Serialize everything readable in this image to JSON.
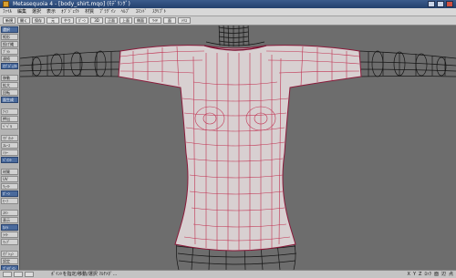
{
  "window": {
    "title": "Metasequoia 4 - [body_shirt.mqo] (ﾓﾃﾞﾘﾝｸﾞ)"
  },
  "menu": [
    "ﾌｧｲﾙ",
    "編集",
    "選択",
    "表示",
    "ｵﾌﾞｼﾞｪｸﾄ",
    "材質",
    "ﾌﾟﾗｸﾞｲﾝ",
    "ﾍﾙﾌﾟ",
    "ｺﾏﾝﾄﾞ",
    "ｽｸﾘﾌﾟﾄ"
  ],
  "toolbar": [
    "新規",
    "開く",
    "保存",
    "元",
    "やり",
    "ﾎﾞｰﾝ",
    "3D",
    "正面",
    "上面",
    "側面",
    "ﾜｲﾔ",
    "面",
    "ﾃｸｽ"
  ],
  "sidebar": {
    "items": [
      {
        "label": "選択",
        "kind": "hdr"
      },
      {
        "label": "矩形",
        "kind": ""
      },
      {
        "label": "投げ縄",
        "kind": ""
      },
      {
        "label": "ﾌﾞﾗｼ",
        "kind": ""
      },
      {
        "label": "連続",
        "kind": ""
      },
      {
        "label": "ｵﾌﾞｼﾞｪｸﾄ",
        "kind": "hdr"
      },
      {
        "label": "移動",
        "kind": "gap"
      },
      {
        "label": "拡大",
        "kind": ""
      },
      {
        "label": "回転",
        "kind": ""
      },
      {
        "label": "面生成",
        "kind": "hdr"
      },
      {
        "label": "ﾅｲﾌ",
        "kind": "gap"
      },
      {
        "label": "押出",
        "kind": ""
      },
      {
        "label": "ﾍﾞﾍﾞﾙ",
        "kind": ""
      },
      {
        "label": "ﾏｸﾞﾈｯﾄ",
        "kind": "gap"
      },
      {
        "label": "ｽﾑｰｽ",
        "kind": ""
      },
      {
        "label": "ﾐﾗｰ",
        "kind": ""
      },
      {
        "label": "ﾍﾟｲﾝﾄ",
        "kind": "hdr"
      },
      {
        "label": "材質",
        "kind": "gap"
      },
      {
        "label": "UV",
        "kind": ""
      },
      {
        "label": "ｳｪｲﾄ",
        "kind": ""
      },
      {
        "label": "ﾎﾞｰﾝ",
        "kind": "hdr"
      },
      {
        "label": "ﾓｰﾌ",
        "kind": ""
      },
      {
        "label": "ｽｷﾝ",
        "kind": "gap"
      },
      {
        "label": "表示",
        "kind": ""
      },
      {
        "label": "ｶﾒﾗ",
        "kind": "hdr"
      },
      {
        "label": "ﾗｲﾄ",
        "kind": ""
      },
      {
        "label": "ﾏｯﾌﾟ",
        "kind": ""
      },
      {
        "label": "ｵﾌﾟｼｮﾝ",
        "kind": "gap"
      },
      {
        "label": "設定",
        "kind": ""
      },
      {
        "label": "ﾌﾟﾗｸﾞｲﾝ",
        "kind": "hdr"
      },
      {
        "label": "ﾍﾙﾌﾟ",
        "kind": ""
      }
    ]
  },
  "status": {
    "text": "ﾎﾟｲﾝﾄを指定/移動/選択 ﾏﾙﾁﾒﾀﾞ…",
    "indicators": [
      "X",
      "Y",
      "Z",
      "ﾛｯｸ",
      "面",
      "辺",
      "点"
    ]
  },
  "colors": {
    "viewport_bg": "#6d6d6d",
    "mesh_fill": "#d7cfd0",
    "mesh_edge": "#c43050",
    "wire": "#1a1a1a"
  }
}
